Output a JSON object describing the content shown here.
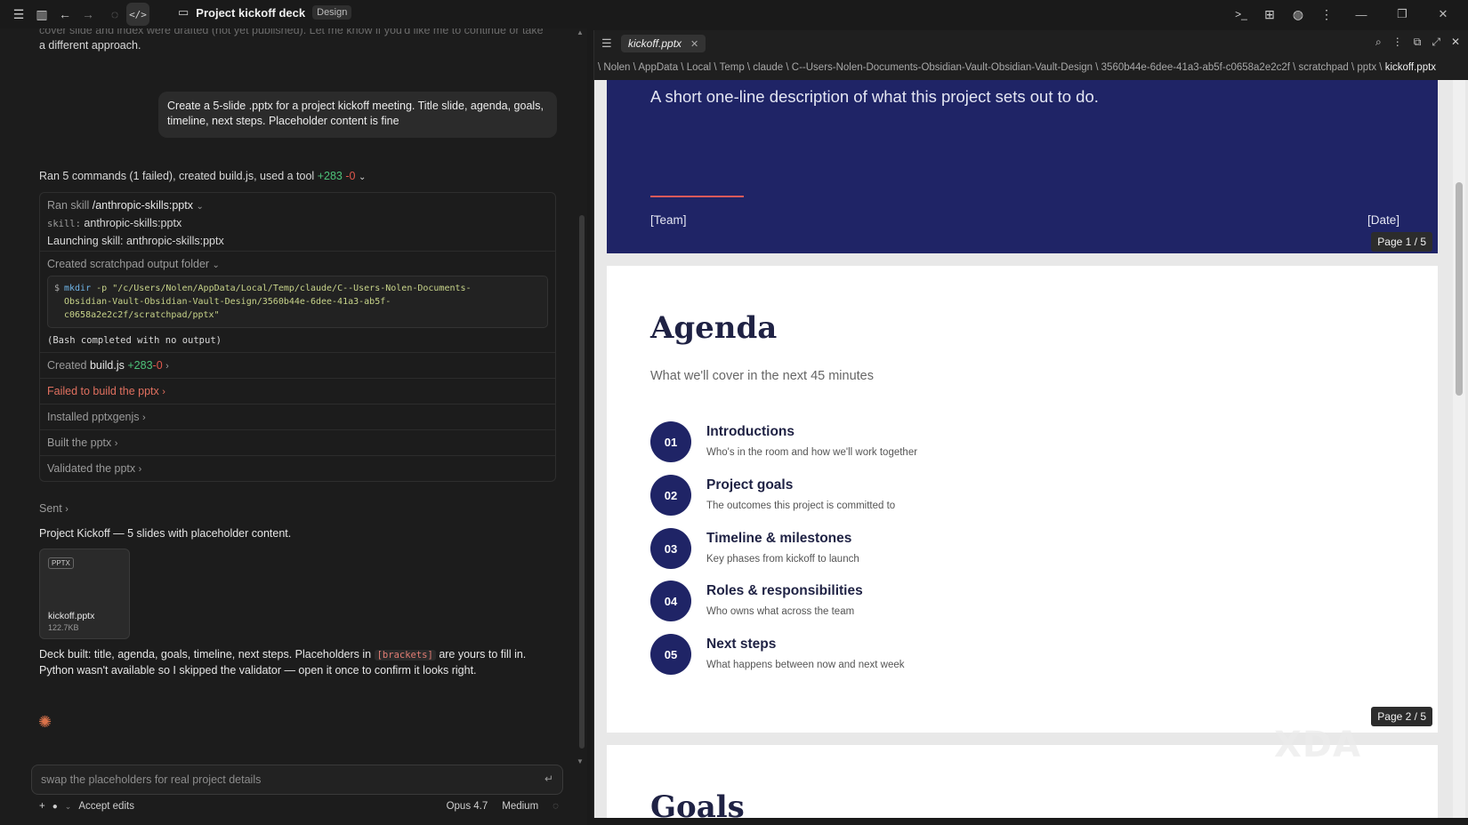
{
  "titlebar": {
    "title": "Project kickoff deck",
    "badge": "Design"
  },
  "chat": {
    "faded_text_1": "cover slide and index were drafted (not yet published). Let me know if you'd like me to continue or take",
    "faded_text_2": "a different approach.",
    "user_message": "Create a 5-slide .pptx for a project kickoff meeting. Title slide, agenda, goals, timeline, next steps. Placeholder content is fine",
    "summary": {
      "text": "Ran 5 commands (1 failed), created build.js, used a tool",
      "added": "+283",
      "removed": "-0"
    },
    "steps": {
      "ran_skill_label": "Ran skill",
      "ran_skill_name": "/anthropic-skills:pptx",
      "skill_key": "skill:",
      "skill_value": "anthropic-skills:pptx",
      "launching": "Launching skill: anthropic-skills:pptx",
      "scratch_label": "Created scratchpad output folder",
      "code_prompt": "$",
      "code_cmd": "mkdir",
      "code_args": "-p \"/c/Users/Nolen/AppData/Local/Temp/claude/C--Users-Nolen-Documents-",
      "code_line2": "Obsidian-Vault-Obsidian-Vault-Design/3560b44e-6dee-41a3-ab5f-",
      "code_line3": "c0658a2e2c2f/scratchpad/pptx\"",
      "bash_out": "(Bash completed with no output)",
      "created_label": "Created",
      "created_file": "build.js",
      "created_added": "+283",
      "created_removed": "-0",
      "failed": "Failed to build the pptx",
      "installed": "Installed pptxgenjs",
      "built": "Built the pptx",
      "validated": "Validated the pptx"
    },
    "sent": "Sent",
    "deck_line": "Project Kickoff — 5 slides with placeholder content.",
    "file": {
      "tag": "PPTX",
      "name": "kickoff.pptx",
      "size": "122.7KB"
    },
    "final_1a": "Deck built: title, agenda, goals, timeline, next steps. Placeholders in",
    "final_code": "[brackets]",
    "final_1b": "are yours to fill in.",
    "final_2": "Python wasn't available so I skipped the validator — open it once to confirm it looks right.",
    "composer_value": "swap the placeholders for real project details",
    "accept_edits": "Accept edits",
    "model": "Opus 4.7",
    "effort": "Medium"
  },
  "viewer": {
    "tab": "kickoff.pptx",
    "breadcrumb_path": "\\ Nolen \\ AppData \\ Local \\ Temp \\ claude \\ C--Users-Nolen-Documents-Obsidian-Vault-Obsidian-Vault-Design \\ 3560b44e-6dee-41a3-ab5f-c0658a2e2c2f \\ scratchpad \\ pptx \\",
    "breadcrumb_last": "kickoff.pptx",
    "slide1": {
      "description": "A short one-line description of what this project sets out to do.",
      "team": "[Team]",
      "date": "[Date]",
      "page": "Page 1 / 5"
    },
    "slide2": {
      "title": "Agenda",
      "subtitle": "What we'll cover in the next 45 minutes",
      "page": "Page 2 / 5",
      "items": [
        {
          "num": "01",
          "title": "Introductions",
          "desc": "Who's in the room and how we'll work together"
        },
        {
          "num": "02",
          "title": "Project goals",
          "desc": "The outcomes this project is committed to"
        },
        {
          "num": "03",
          "title": "Timeline & milestones",
          "desc": "Key phases from kickoff to launch"
        },
        {
          "num": "04",
          "title": "Roles & responsibilities",
          "desc": "Who owns what across the team"
        },
        {
          "num": "05",
          "title": "Next steps",
          "desc": "What happens between now and next week"
        }
      ]
    },
    "slide3": {
      "title": "Goals"
    }
  },
  "watermark": "XDA"
}
